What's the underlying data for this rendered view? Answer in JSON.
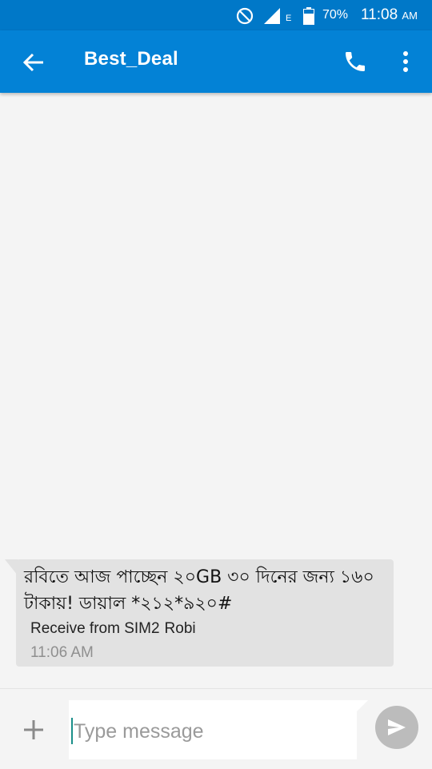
{
  "status_bar": {
    "network_type": "E",
    "battery_percent": "70%",
    "time": "11:08",
    "ampm": "AM",
    "icons": [
      "do-not-disturb-icon",
      "signal-icon",
      "battery-icon"
    ]
  },
  "app_bar": {
    "title": "Best_Deal",
    "icons": [
      "back-arrow-icon",
      "phone-call-icon",
      "more-vert-icon"
    ],
    "color": "#0382d6"
  },
  "conversation": {
    "messages": [
      {
        "text": "রবিতে আজ পাচ্ছেন ২০GB ৩০ দিনের জন্য ১৬০ টাকায়! ডায়াল *২১২*৯২০#",
        "sim_label": "Receive from SIM2",
        "carrier": "Robi",
        "time": "11:06 AM"
      }
    ]
  },
  "compose": {
    "placeholder": "Type message",
    "value": "",
    "icons": [
      "add-icon",
      "send-icon"
    ]
  }
}
